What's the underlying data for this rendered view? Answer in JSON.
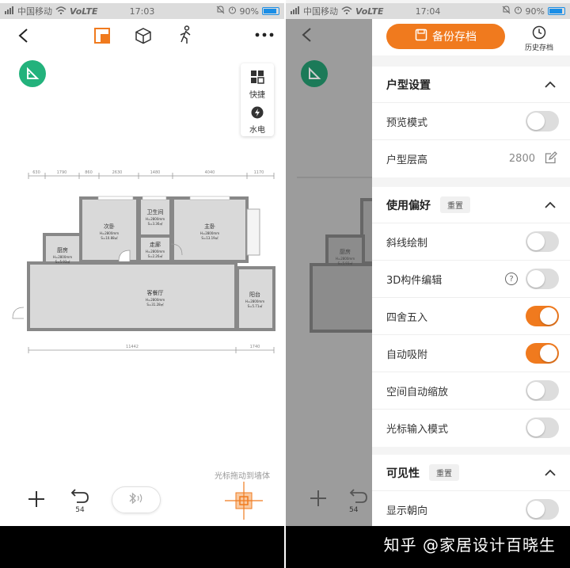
{
  "left_status": {
    "carrier": "中国移动",
    "network": "VoLTE",
    "time": "17:03",
    "battery": "90%"
  },
  "right_status": {
    "carrier": "中国移动",
    "network": "VoLTE",
    "time": "17:04",
    "battery": "90%"
  },
  "quick_panel": {
    "shortcut_label": "快捷",
    "water_elec_label": "水电"
  },
  "floorplan": {
    "dims_top": [
      "630",
      "1790",
      "860",
      "2630",
      "1480",
      "4040",
      "1170"
    ],
    "dims_bottom": [
      "11442",
      "1740"
    ],
    "rooms": [
      {
        "name": "次卧",
        "height": "H=2800mm",
        "area": "S=10.88㎡"
      },
      {
        "name": "卫生间",
        "height": "H=2800mm",
        "area": "S=3.36㎡"
      },
      {
        "name": "主卧",
        "height": "H=2800mm",
        "area": "S=13.19㎡"
      },
      {
        "name": "走廊",
        "height": "H=2800mm",
        "area": "S=2.26㎡"
      },
      {
        "name": "厨房",
        "height": "H=2800mm",
        "area": "S=5.93㎡"
      },
      {
        "name": "客餐厅",
        "height": "H=2800mm",
        "area": "S=31.28㎡"
      },
      {
        "name": "阳台",
        "height": "H=2800mm",
        "area": "S=5.71㎡"
      }
    ]
  },
  "bottom": {
    "hint": "光标拖动到墙体",
    "undo_count": "54"
  },
  "panel": {
    "backup_label": "备份存档",
    "history_label": "历史存档",
    "section_layout": {
      "title": "户型设置",
      "preview_label": "预览模式",
      "preview_on": false,
      "floor_height_label": "户型层高",
      "floor_height_value": "2800"
    },
    "section_prefs": {
      "title": "使用偏好",
      "reset_label": "重置",
      "items": [
        {
          "label": "斜线绘制",
          "on": false
        },
        {
          "label": "3D构件编辑",
          "on": false,
          "help": "?"
        },
        {
          "label": "四舍五入",
          "on": true
        },
        {
          "label": "自动吸附",
          "on": true
        },
        {
          "label": "空间自动缩放",
          "on": false
        },
        {
          "label": "光标输入模式",
          "on": false
        }
      ]
    },
    "section_visibility": {
      "title": "可见性",
      "reset_label": "重置",
      "items": [
        {
          "label": "显示朝向",
          "on": false
        }
      ]
    }
  },
  "watermark": "知乎 @家居设计百晓生",
  "colors": {
    "accent": "#f07a1e",
    "green_badge": "#23b27c",
    "toggle_off": "#dddddd"
  }
}
